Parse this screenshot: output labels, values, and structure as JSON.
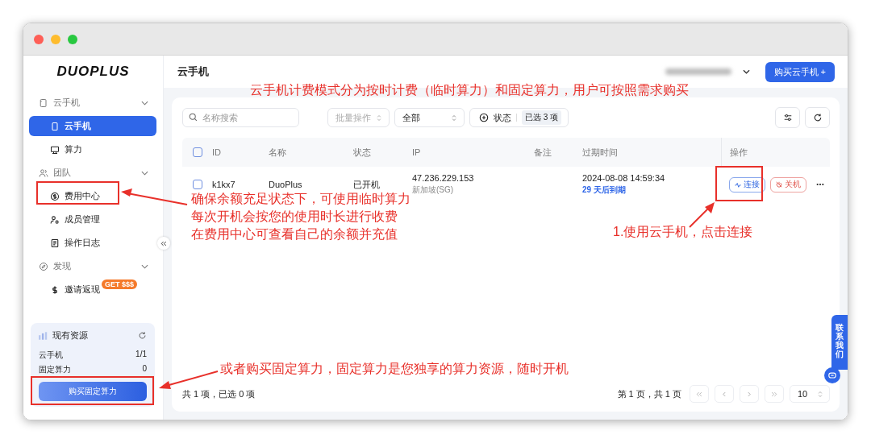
{
  "sidebar": {
    "logo": "DUOPLUS",
    "groups": [
      {
        "label": "云手机",
        "expanded": true,
        "items": [
          {
            "label": "云手机",
            "selected": true
          },
          {
            "label": "算力",
            "selected": false
          }
        ]
      },
      {
        "label": "团队",
        "expanded": true,
        "items": [
          {
            "label": "费用中心",
            "selected": false
          },
          {
            "label": "成员管理",
            "selected": false
          },
          {
            "label": "操作日志",
            "selected": false
          }
        ]
      },
      {
        "label": "发现",
        "expanded": true,
        "items": [
          {
            "label": "邀请返现",
            "selected": false,
            "badge": "GET $$$"
          }
        ]
      }
    ],
    "resources": {
      "title": "现有资源",
      "rows": [
        {
          "label": "云手机",
          "value": "1/1"
        },
        {
          "label": "固定算力",
          "value": "0"
        }
      ],
      "button": "购买固定算力"
    }
  },
  "header": {
    "title": "云手机",
    "buy_button": "购买云手机 +"
  },
  "toolbar": {
    "search": {
      "placeholder": "名称搜索"
    },
    "batch": {
      "label": "批量操作",
      "disabled": true
    },
    "filter": {
      "value": "全部"
    },
    "status": {
      "label": "状态",
      "chip": "已选 3 项"
    }
  },
  "table": {
    "select_all": {
      "checked": false
    },
    "columns": [
      "ID",
      "名称",
      "状态",
      "IP",
      "备注",
      "过期时间",
      "操作"
    ],
    "rows": [
      {
        "checked": false,
        "id": "k1kx7",
        "name": "DuoPlus",
        "status": "已开机",
        "ip": "47.236.229.153",
        "region": "新加坡(SG)",
        "expires": "2024-08-08 14:59:34",
        "remaining": "29 天后到期",
        "connect": "连接",
        "shutdown": "关机"
      }
    ]
  },
  "footer": {
    "summary": "共 1 项，已选 0 项",
    "pages": "第 1 页，共 1 页",
    "page_size": "10"
  },
  "contact": {
    "label": "联系我们"
  },
  "annotations": [
    {
      "kind": "top",
      "text": "云手机计费模式分为按时计费（临时算力）和固定算力，用户可按照需求购买"
    },
    {
      "kind": "fee",
      "lines": [
        "确保余额充足状态下，可使用临时算力",
        "每次开机会按您的使用时长进行收费",
        "在费用中心可查看自己的余额并充值"
      ]
    },
    {
      "kind": "connect",
      "text": "1.使用云手机，点击连接"
    },
    {
      "kind": "buy",
      "text": "或者购买固定算力，固定算力是您独享的算力资源，随时开机"
    }
  ]
}
